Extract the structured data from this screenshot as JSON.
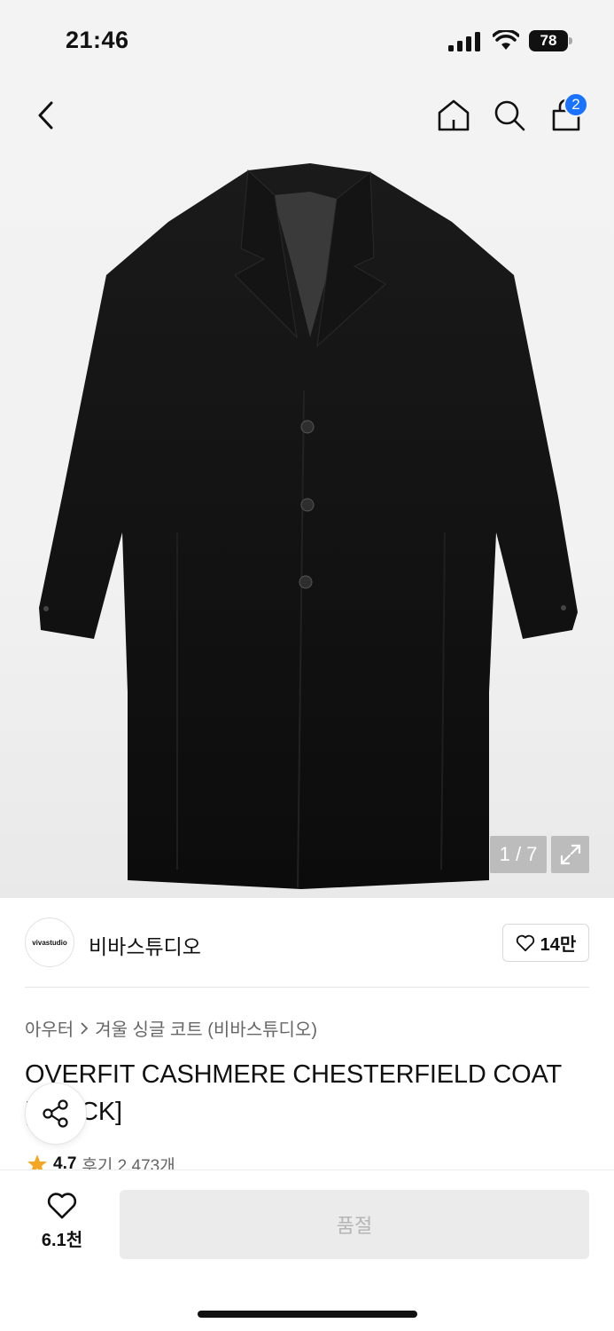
{
  "status_bar": {
    "time": "21:46",
    "battery": "78"
  },
  "gallery": {
    "page_indicator": "1 / 7"
  },
  "cart": {
    "badge_count": "2"
  },
  "brand": {
    "logo_text": "vivastudio",
    "name": "비바스튜디오",
    "like_count": "14만"
  },
  "breadcrumb": {
    "category": "아우터",
    "subcategory": "겨울 싱글 코트 (비바스튜디오)"
  },
  "product": {
    "title": "OVERFIT CASHMERE CHESTERFIELD COAT [BLACK]"
  },
  "rating": {
    "value": "4.7",
    "reviews": "후기 2,473개"
  },
  "bottom": {
    "wish_count": "6.1천",
    "purchase_label": "품절"
  },
  "colors": {
    "accent": "#1a73ff",
    "rating_star": "#f5a623",
    "disabled_bg": "#ebebeb"
  }
}
